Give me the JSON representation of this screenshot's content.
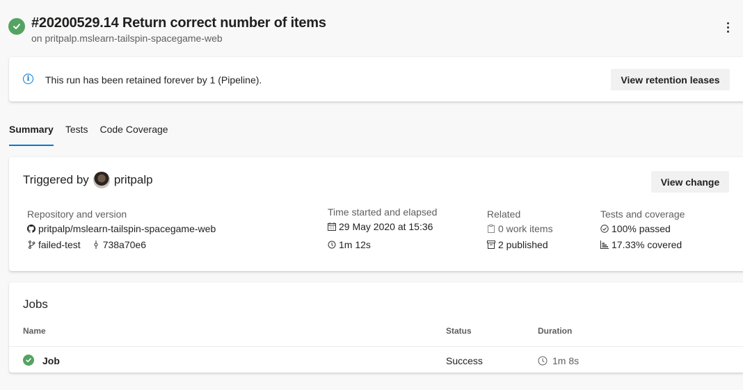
{
  "header": {
    "title": "#20200529.14 Return correct number of items",
    "subtitle": "on pritpalp.mslearn-tailspin-spacegame-web",
    "status_icon": "check-circle-icon",
    "status_color": "#55a362"
  },
  "banner": {
    "text": "This run has been retained forever by 1 (Pipeline).",
    "button_label": "View retention leases",
    "icon": "info-icon"
  },
  "tabs": [
    {
      "label": "Summary",
      "active": true
    },
    {
      "label": "Tests",
      "active": false
    },
    {
      "label": "Code Coverage",
      "active": false
    }
  ],
  "summary": {
    "triggered_prefix": "Triggered by",
    "triggered_user": "pritpalp",
    "view_change_label": "View change",
    "repository": {
      "label": "Repository and version",
      "repo": "pritpalp/mslearn-tailspin-spacegame-web",
      "branch": "failed-test",
      "commit": "738a70e6"
    },
    "time": {
      "label": "Time started and elapsed",
      "started": "29 May 2020 at 15:36",
      "elapsed": "1m 12s"
    },
    "related": {
      "label": "Related",
      "work_items": "0 work items",
      "published": "2 published"
    },
    "tests": {
      "label": "Tests and coverage",
      "passed": "100% passed",
      "covered": "17.33% covered"
    }
  },
  "jobs": {
    "title": "Jobs",
    "columns": {
      "name": "Name",
      "status": "Status",
      "duration": "Duration"
    },
    "rows": [
      {
        "name": "Job",
        "status": "Success",
        "duration": "1m 8s"
      }
    ]
  },
  "colors": {
    "accent": "#0078d4",
    "success": "#55a362"
  }
}
